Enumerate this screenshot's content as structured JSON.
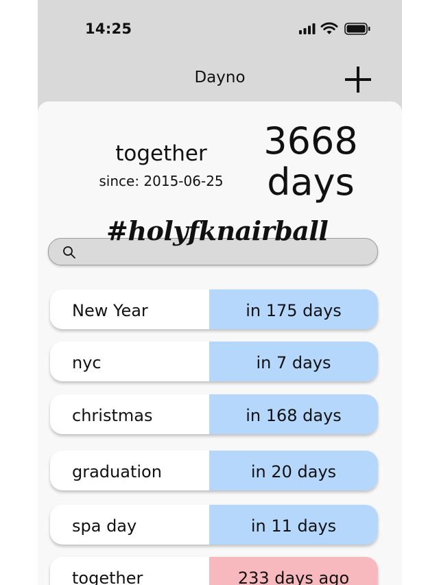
{
  "status_bar": {
    "time": "14:25",
    "icons": [
      "cellular-signal-icon",
      "wifi-icon",
      "battery-icon"
    ]
  },
  "header": {
    "title": "Dayno",
    "add_icon": "plus-icon"
  },
  "featured": {
    "name": "together",
    "since": "since: 2015-06-25",
    "count": "3668",
    "unit": "days"
  },
  "hashtag": "#holyfknairball",
  "search": {
    "placeholder": "",
    "icon": "search-icon"
  },
  "events": [
    {
      "name": "New Year",
      "countdown": "in 175 days",
      "status": "future"
    },
    {
      "name": "nyc",
      "countdown": "in 7 days",
      "status": "future"
    },
    {
      "name": "christmas",
      "countdown": "in 168 days",
      "status": "future"
    },
    {
      "name": "graduation",
      "countdown": "in 20 days",
      "status": "future"
    },
    {
      "name": "spa day",
      "countdown": "in 11 days",
      "status": "future"
    },
    {
      "name": "together",
      "countdown": "233 days ago",
      "status": "past"
    }
  ],
  "colors": {
    "future": "#b4d7fb",
    "past": "#f7b9bd",
    "header_bg": "#d9d9d9",
    "sheet_bg": "#f8f8f8"
  }
}
